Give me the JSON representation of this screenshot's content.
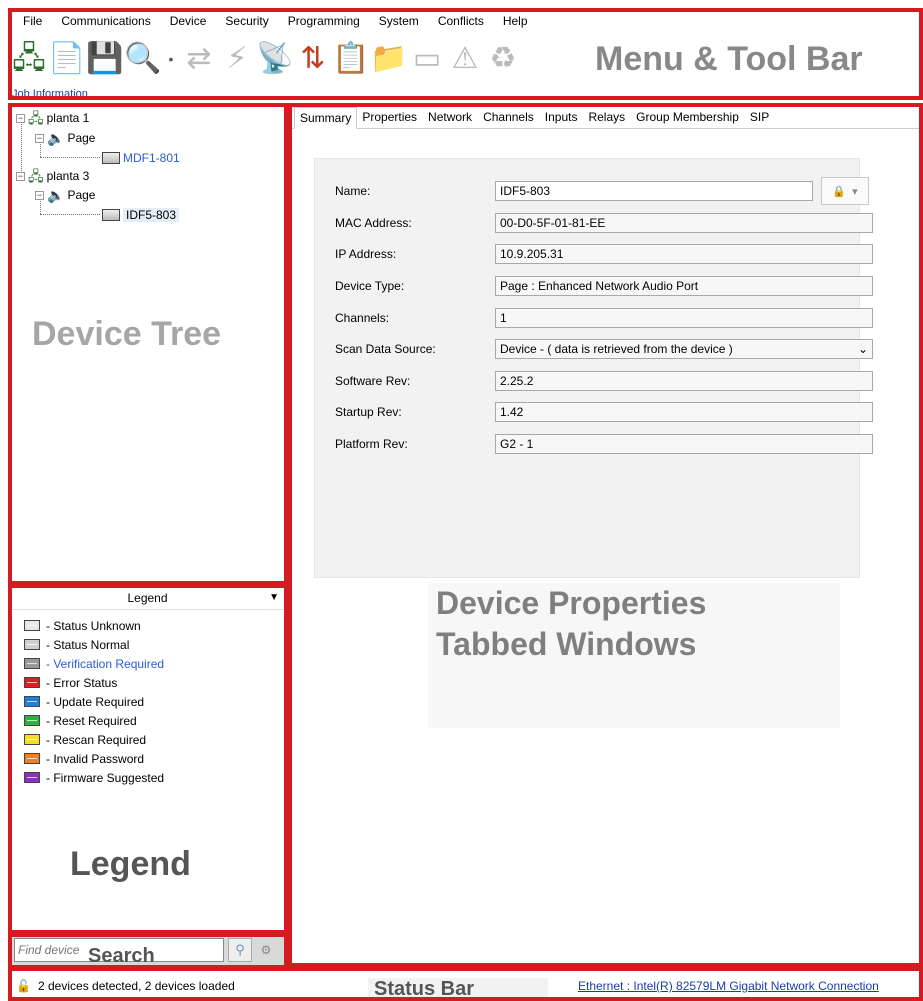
{
  "menu": {
    "items": [
      "File",
      "Communications",
      "Device",
      "Security",
      "Programming",
      "System",
      "Conflicts",
      "Help"
    ]
  },
  "toolbar": {
    "icons": [
      "network-computer-icon",
      "document-import-icon",
      "save-disk-icon",
      "search-device-icon",
      "dropdown-arrow-icon",
      "connect-icon",
      "lightning-icon",
      "antenna-icon",
      "transfer-icon",
      "clipboard-icon",
      "folder-icon",
      "display-icon",
      "warning-icon",
      "recycle-icon"
    ],
    "annotation": "Menu & Tool Bar",
    "job_info": "Job Information"
  },
  "tree": {
    "nodes": [
      {
        "label": "planta 1",
        "level": 0,
        "expander": "−"
      },
      {
        "label": "Page",
        "level": 1,
        "expander": "−"
      },
      {
        "label": "MDF1-801",
        "level": 2,
        "expander": ""
      },
      {
        "label": "planta 3",
        "level": 0,
        "expander": "−"
      },
      {
        "label": "Page",
        "level": 1,
        "expander": "−"
      },
      {
        "label": "IDF5-803",
        "level": 2,
        "expander": ""
      }
    ],
    "annotation": "Device Tree"
  },
  "legend": {
    "title": "Legend",
    "items": [
      {
        "label": "- Status Unknown",
        "color": "#e8e8e8"
      },
      {
        "label": "- Status Normal",
        "color": "#cfcfcf"
      },
      {
        "label": "- Verification Required",
        "color": "#9a9a9a"
      },
      {
        "label": "- Error Status",
        "color": "#d82020"
      },
      {
        "label": "- Update Required",
        "color": "#2080d8"
      },
      {
        "label": "- Reset Required",
        "color": "#30b040"
      },
      {
        "label": "- Rescan Required",
        "color": "#f0e020"
      },
      {
        "label": "- Invalid Password",
        "color": "#f08020"
      },
      {
        "label": "- Firmware Suggested",
        "color": "#9030c0"
      }
    ],
    "annotation": "Legend"
  },
  "search": {
    "placeholder": "Find device",
    "annotation": "Search"
  },
  "props": {
    "tabs": [
      "Summary",
      "Properties",
      "Network",
      "Channels",
      "Inputs",
      "Relays",
      "Group Membership",
      "SIP"
    ],
    "fields": [
      {
        "label": "Name:",
        "value": "IDF5-803"
      },
      {
        "label": "MAC Address:",
        "value": "00-D0-5F-01-81-EE"
      },
      {
        "label": "IP Address:",
        "value": "10.9.205.31"
      },
      {
        "label": "Device Type:",
        "value": "Page : Enhanced Network Audio Port"
      },
      {
        "label": "Channels:",
        "value": "1"
      },
      {
        "label": "Scan Data Source:",
        "value": "Device - ( data is retrieved from the device )"
      },
      {
        "label": "Software Rev:",
        "value": "2.25.2"
      },
      {
        "label": "Startup Rev:",
        "value": "1.42"
      },
      {
        "label": "Platform Rev:",
        "value": "G2 - 1"
      }
    ],
    "annotation_line1": "Device Properties",
    "annotation_line2": "Tabbed Windows"
  },
  "status": {
    "text": "2 devices detected, 2 devices loaded",
    "link": "Ethernet : Intel(R) 82579LM Gigabit Network Connection",
    "annotation": "Status Bar"
  },
  "colors": {
    "annotation_box": "#d71920",
    "link": "#1a3fa0"
  }
}
